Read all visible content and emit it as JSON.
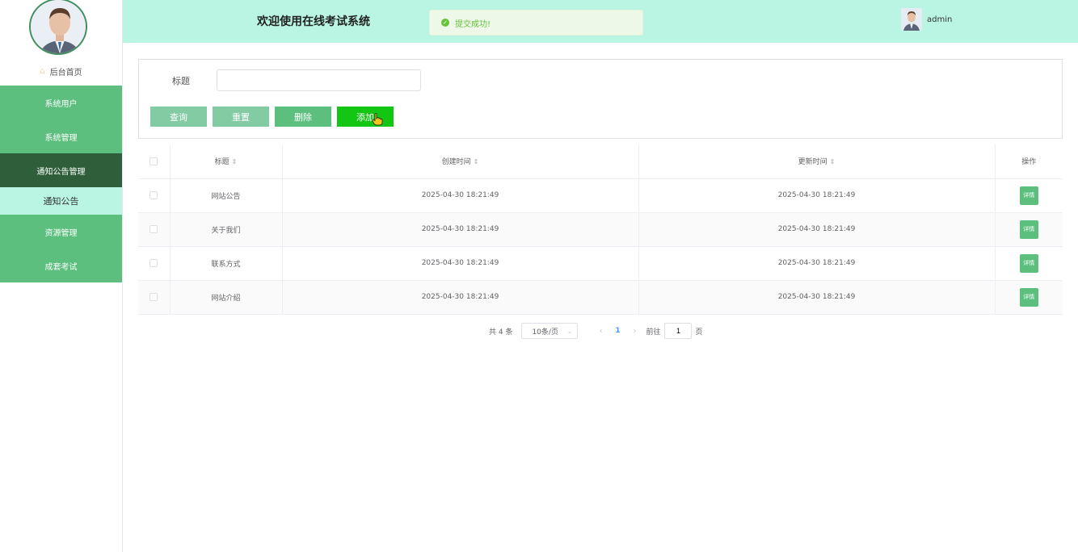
{
  "sidebar": {
    "home_label": "后台首页",
    "items": [
      {
        "label": "系统用户"
      },
      {
        "label": "系统管理"
      },
      {
        "label": "通知公告管理"
      },
      {
        "label": "通知公告"
      },
      {
        "label": "资源管理"
      },
      {
        "label": "成套考试"
      }
    ]
  },
  "header": {
    "title": "欢迎使用在线考试系统",
    "toast": "提交成功!",
    "username": "admin"
  },
  "search": {
    "title_label": "标题",
    "title_value": "",
    "buttons": {
      "query": "查询",
      "reset": "重置",
      "delete": "删除",
      "add": "添加"
    }
  },
  "table": {
    "columns": {
      "title": "标题",
      "created": "创建时间",
      "updated": "更新时间",
      "actions": "操作"
    },
    "rows": [
      {
        "title": "网站公告",
        "created": "2025-04-30 18:21:49",
        "updated": "2025-04-30 18:21:49",
        "action": "详情"
      },
      {
        "title": "关于我们",
        "created": "2025-04-30 18:21:49",
        "updated": "2025-04-30 18:21:49",
        "action": "详情"
      },
      {
        "title": "联系方式",
        "created": "2025-04-30 18:21:49",
        "updated": "2025-04-30 18:21:49",
        "action": "详情"
      },
      {
        "title": "网站介绍",
        "created": "2025-04-30 18:21:49",
        "updated": "2025-04-30 18:21:49",
        "action": "详情"
      }
    ]
  },
  "pagination": {
    "total": "共 4 条",
    "page_size": "10条/页",
    "current_page": "1",
    "goto_label": "前往",
    "goto_value": "1",
    "page_suffix": "页"
  },
  "colors": {
    "header_bg": "#b9f5e2",
    "menu_bg": "#5cbf7e",
    "menu_active_bg": "#2e5e3a",
    "add_button": "#13c613",
    "success": "#67c23a"
  }
}
